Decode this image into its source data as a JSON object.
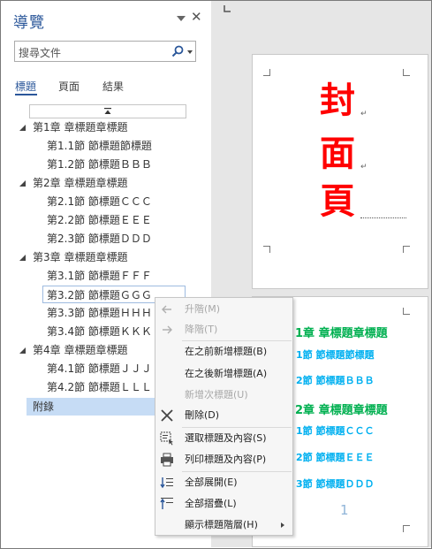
{
  "nav": {
    "title": "導覽",
    "search_placeholder": "搜尋文件",
    "tabs": [
      "標題",
      "頁面",
      "結果"
    ],
    "tree": [
      {
        "label": "第1章 章標題章標題",
        "level": 1
      },
      {
        "label": "第1.1節 節標題節標題",
        "level": 2
      },
      {
        "label": "第1.2節 節標題ＢＢＢ",
        "level": 2
      },
      {
        "label": "第2章 章標題章標題",
        "level": 1
      },
      {
        "label": "第2.1節 節標題ＣＣＣ",
        "level": 2
      },
      {
        "label": "第2.2節 節標題ＥＥＥ",
        "level": 2
      },
      {
        "label": "第2.3節 節標題ＤＤＤ",
        "level": 2
      },
      {
        "label": "第3章 章標題章標題",
        "level": 1
      },
      {
        "label": "第3.1節 節標題ＦＦＦ",
        "level": 2
      },
      {
        "label": "第3.2節 節標題ＧＧＧ",
        "level": 2
      },
      {
        "label": "第3.3節 節標題ＨＨＨ",
        "level": 2
      },
      {
        "label": "第3.4節 節標題ＫＫＫ",
        "level": 2
      },
      {
        "label": "第4章 章標題章標題",
        "level": 1
      },
      {
        "label": "第4.1節 節標題ＪＪＪ",
        "level": 2
      },
      {
        "label": "第4.2節 節標題ＬＬＬ",
        "level": 2
      },
      {
        "label": "附錄",
        "level": 1
      }
    ]
  },
  "document": {
    "cover_chars": [
      "封",
      "面",
      "頁"
    ],
    "toc_lines": [
      {
        "text": "1章 章標題章標題",
        "kind": "h1"
      },
      {
        "text": "1節 節標題節標題",
        "kind": "h2"
      },
      {
        "text": "2節 節標題ＢＢＢ",
        "kind": "h2"
      },
      {
        "text": "2章 章標題章標題",
        "kind": "h1"
      },
      {
        "text": "1節 節標題ＣＣＣ",
        "kind": "h2"
      },
      {
        "text": "2節 節標題ＥＥＥ",
        "kind": "h2"
      },
      {
        "text": "3節 節標題ＤＤＤ",
        "kind": "h2"
      }
    ],
    "page_number": "1"
  },
  "context_menu": {
    "items": [
      {
        "label": "升階(M)",
        "icon": "arrow-left-icon",
        "disabled": true
      },
      {
        "label": "降階(T)",
        "icon": "arrow-right-icon",
        "disabled": true
      },
      {
        "label": "在之前新增標題(B)",
        "icon": "",
        "disabled": false
      },
      {
        "label": "在之後新增標題(A)",
        "icon": "",
        "disabled": false
      },
      {
        "label": "新增次標題(U)",
        "icon": "",
        "disabled": true
      },
      {
        "label": "刪除(D)",
        "icon": "delete-x-icon",
        "disabled": false
      },
      {
        "label": "選取標題及內容(S)",
        "icon": "select-heading-icon",
        "disabled": false
      },
      {
        "label": "列印標題及內容(P)",
        "icon": "printer-icon",
        "disabled": false
      },
      {
        "label": "全部展開(E)",
        "icon": "expand-all-icon",
        "disabled": false
      },
      {
        "label": "全部摺疊(L)",
        "icon": "collapse-all-icon",
        "disabled": false
      },
      {
        "label": "顯示標題階層(H)",
        "icon": "",
        "disabled": false,
        "submenu": true
      }
    ]
  },
  "colors": {
    "accent": "#2b579a",
    "cover_red": "#ff0000",
    "toc_green": "#00b050",
    "toc_blue": "#00b0f0",
    "selection": "#c6dcf5"
  }
}
